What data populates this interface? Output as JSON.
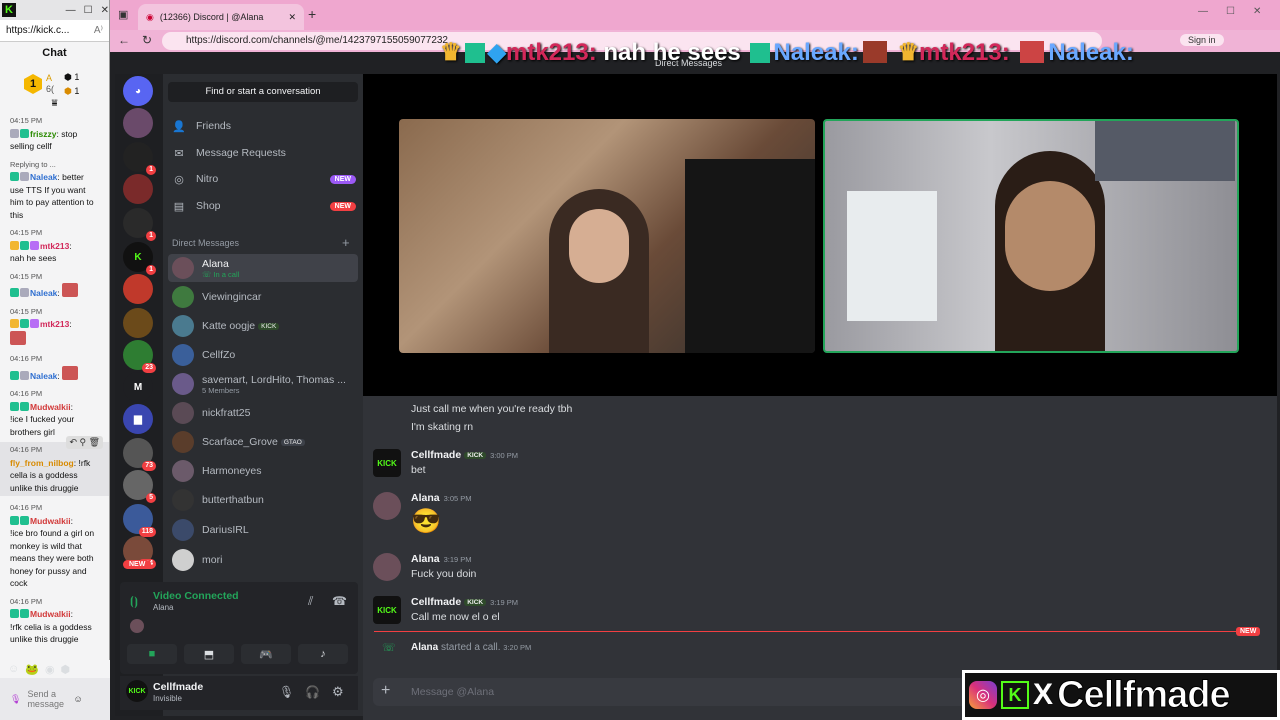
{
  "kick_window": {
    "url": "https://kick.c...",
    "chat_title": "Chat",
    "badge_count_1": "1",
    "badge_count_2": "1",
    "badge_letter": "A",
    "badge_num": "6(",
    "messages": [
      {
        "time": "04:15 PM",
        "user": "friszzy",
        "text": "stop selling cellf"
      },
      {
        "time": "",
        "user": "",
        "text": "Replying to ..."
      },
      {
        "time": "",
        "user": "Naleak",
        "text": "better use TTS If you want him to pay attention to this"
      },
      {
        "time": "04:15 PM",
        "user": "mtk213",
        "text": "nah he sees"
      },
      {
        "time": "04:15 PM",
        "user": "Naleak",
        "text": ""
      },
      {
        "time": "04:15 PM",
        "user": "mtk213",
        "text": ""
      },
      {
        "time": "04:16 PM",
        "user": "Naleak",
        "text": ""
      },
      {
        "time": "04:16 PM",
        "user": "Mudwalkii",
        "text": "!ice I fucked your brothers girl"
      },
      {
        "time": "04:16 PM",
        "user": "fly_from_nilbog",
        "text": "!rfk cella is a goddess unlike this druggie"
      },
      {
        "time": "04:16 PM",
        "user": "Mudwalkii",
        "text": "!ice bro found a girl on monkey is wild that means they were both honey for pussy and cock"
      },
      {
        "time": "04:16 PM",
        "user": "Mudwalkii",
        "text": "!rfk celia is a goddess unlike this druggie"
      }
    ],
    "send_placeholder": "Send a message"
  },
  "browser": {
    "tab_title": "(12366) Discord | @Alana",
    "url": "https://discord.com/channels/@me/1423797155059077232",
    "sign_in": "Sign in"
  },
  "ticker": {
    "text": "mtk213: nah he sees",
    "name2": "Naleak:",
    "name3": "mtk213:",
    "name4": "Naleak:"
  },
  "discord": {
    "header_title": "Direct Messages",
    "find": "Find or start a conversation",
    "nav": {
      "friends": "Friends",
      "requests": "Message Requests",
      "nitro": "Nitro",
      "shop": "Shop",
      "new_badge": "NEW"
    },
    "dm_label": "Direct Messages",
    "dms": [
      {
        "name": "Alana",
        "sub": "In a call",
        "color": "#6b4f5a"
      },
      {
        "name": "Viewingincar",
        "sub": "",
        "color": "#3f7a3f"
      },
      {
        "name": "Katte oogje",
        "sub": "",
        "tag": "KICK",
        "color": "#4a7a8f"
      },
      {
        "name": "CellfZo",
        "sub": "",
        "color": "#3a5f9a"
      },
      {
        "name": "savemart, LordHito, Thomas ...",
        "sub": "5 Members",
        "color": "#6a5a8a"
      },
      {
        "name": "nickfratt25",
        "sub": "",
        "color": "#5a4a55"
      },
      {
        "name": "Scarface_Grove",
        "sub": "",
        "tag": "GTAO",
        "color": "#5a3d2b"
      },
      {
        "name": "Harmoneyes",
        "sub": "",
        "color": "#6b5a6a"
      },
      {
        "name": "butterthatbun",
        "sub": "",
        "color": "#333"
      },
      {
        "name": "DariusIRL",
        "sub": "",
        "color": "#3b4a6a"
      },
      {
        "name": "mori",
        "sub": "",
        "color": "#cfcfcf"
      }
    ],
    "server_badges": [
      "1",
      "1",
      "1",
      "1",
      "23",
      "73",
      "5",
      "118",
      "264",
      "NEW"
    ],
    "voice": {
      "status": "Video Connected",
      "channel": "Alana"
    },
    "user": {
      "name": "Cellfmade",
      "status": "Invisible"
    },
    "messages": {
      "line1": "Just call me when you're ready tbh",
      "line2": "I'm skating rn",
      "m1": {
        "name": "Cellfmade",
        "tag": "KICK",
        "time": "3:00 PM",
        "text": "bet"
      },
      "m2": {
        "name": "Alana",
        "time": "3:05 PM",
        "text": "😎"
      },
      "m3": {
        "name": "Alana",
        "time": "3:19 PM",
        "text": "Fuck you doin"
      },
      "m4": {
        "name": "Cellfmade",
        "tag": "KICK",
        "time": "3:19 PM",
        "text": "Call me now el o el"
      },
      "call_name": "Alana",
      "call_text": "started a call.",
      "call_time": "3:20 PM",
      "new_label": "NEW"
    },
    "message_placeholder": "Message @Alana"
  },
  "branding": {
    "x": "X",
    "name": "Cellfmade"
  }
}
